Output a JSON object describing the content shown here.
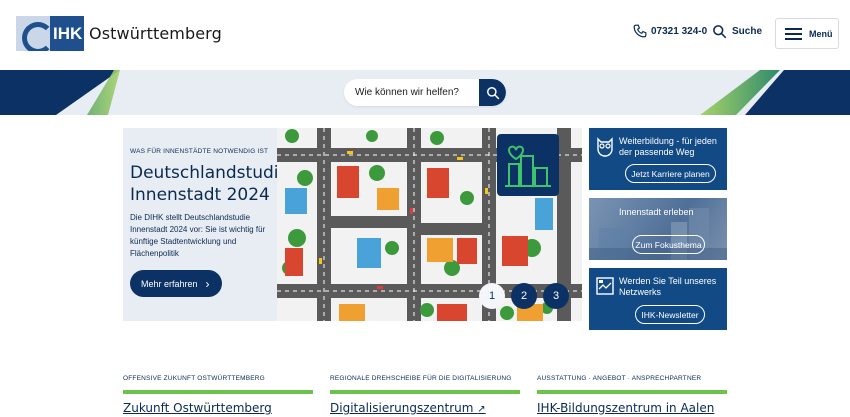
{
  "header": {
    "logo_mark": "IHK",
    "logo_name": "Ostwürttemberg",
    "phone": "07321 324-0",
    "search_label": "Suche",
    "menu_label": "Menü"
  },
  "search": {
    "placeholder": "Wie können wir helfen?"
  },
  "hero": {
    "kicker": "WAS FÜR INNENSTÄDTE NOTWENDIG IST",
    "title": "Deutschlandstudie Innenstadt 2024",
    "description": "Die DIHK stellt Deutschlandstudie Innenstadt 2024 vor: Sie ist wichtig für künftige Stadtentwicklung und Flächenpolitik",
    "button_label": "Mehr erfahren",
    "slides": [
      "1",
      "2",
      "3"
    ],
    "active_slide": "1"
  },
  "cards": [
    {
      "title": "Weiterbildung - für jeden der passende Weg",
      "button": "Jetzt Karriere planen",
      "icon": "owl-icon"
    },
    {
      "title": "Innenstadt erleben",
      "button": "Zum Fokusthema",
      "icon": "city-photo"
    },
    {
      "title": "Werden Sie Teil unseres Netzwerks",
      "button": "IHK-Newsletter",
      "icon": "newsletter-icon"
    }
  ],
  "teasers": [
    {
      "kicker": "OFFENSIVE ZUKUNFT OSTWÜRTTEMBERG",
      "title": "Zukunft Ostwürttemberg"
    },
    {
      "kicker": "REGIONALE DREHSCHEIBE FÜR DIE DIGITALISIERUNG",
      "title": "Digitalisierungszentrum",
      "external": true
    },
    {
      "kicker": "AUSSTATTUNG · ANGEBOT · ANSPRECHPARTNER",
      "title": "IHK-Bildungszentrum in Aalen"
    }
  ],
  "colors": {
    "navy": "#0c3265",
    "card_blue": "#124a85",
    "accent_green": "#6cc24a",
    "band_bg": "#e8edf3"
  }
}
